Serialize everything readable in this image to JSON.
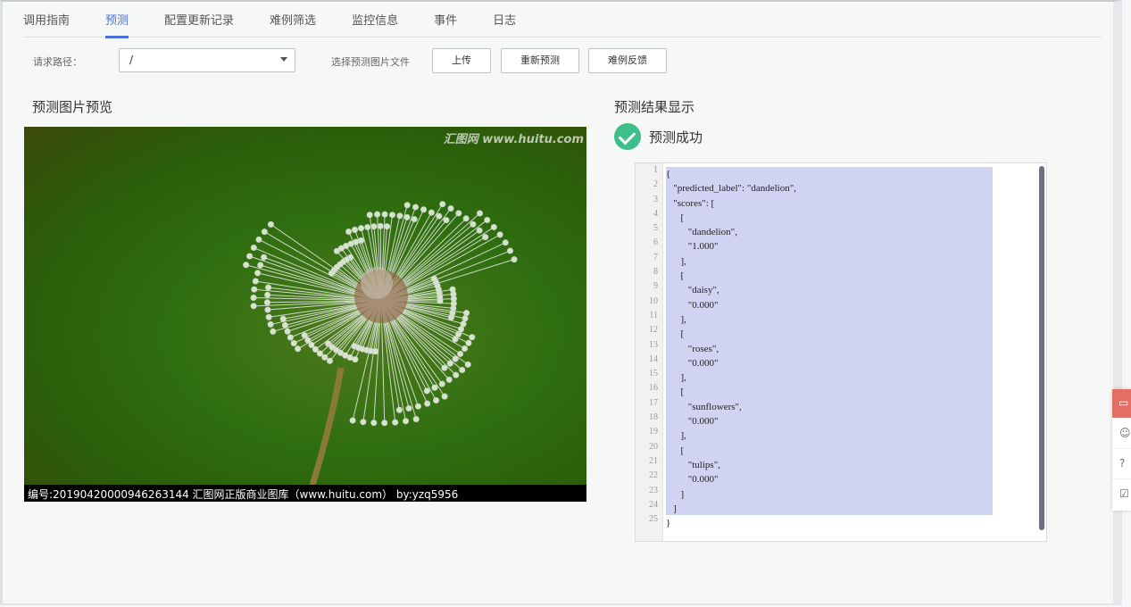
{
  "tabs": [
    "调用指南",
    "预测",
    "配置更新记录",
    "难例筛选",
    "监控信息",
    "事件",
    "日志"
  ],
  "active_tab": 1,
  "toolbar": {
    "path_label": "请求路径：",
    "path_value": "/",
    "file_label": "选择预测图片文件",
    "upload": "上传",
    "repredict": "重新预测",
    "feedback": "难例反馈"
  },
  "preview": {
    "title": "预测图片预览",
    "watermark": "汇图网 www.huitu.com",
    "caption": "编号:20190420000946263144 汇图网正版商业图库（www.huitu.com） by:yzq5956"
  },
  "result": {
    "title": "预测结果显示",
    "status": "预测成功",
    "status_color": "#3dbe8a",
    "lines": [
      "{",
      "   \"predicted_label\": \"dandelion\",",
      "   \"scores\": [",
      "      [",
      "         \"dandelion\",",
      "         \"1.000\"",
      "      ],",
      "      [",
      "         \"daisy\",",
      "         \"0.000\"",
      "      ],",
      "      [",
      "         \"roses\",",
      "         \"0.000\"",
      "      ],",
      "      [",
      "         \"sunflowers\",",
      "         \"0.000\"",
      "      ],",
      "      [",
      "         \"tulips\",",
      "         \"0.000\"",
      "      ]",
      "   ]",
      "}"
    ]
  },
  "side_tools": [
    "chat-icon",
    "smile-icon",
    "help-icon",
    "edit-icon"
  ]
}
